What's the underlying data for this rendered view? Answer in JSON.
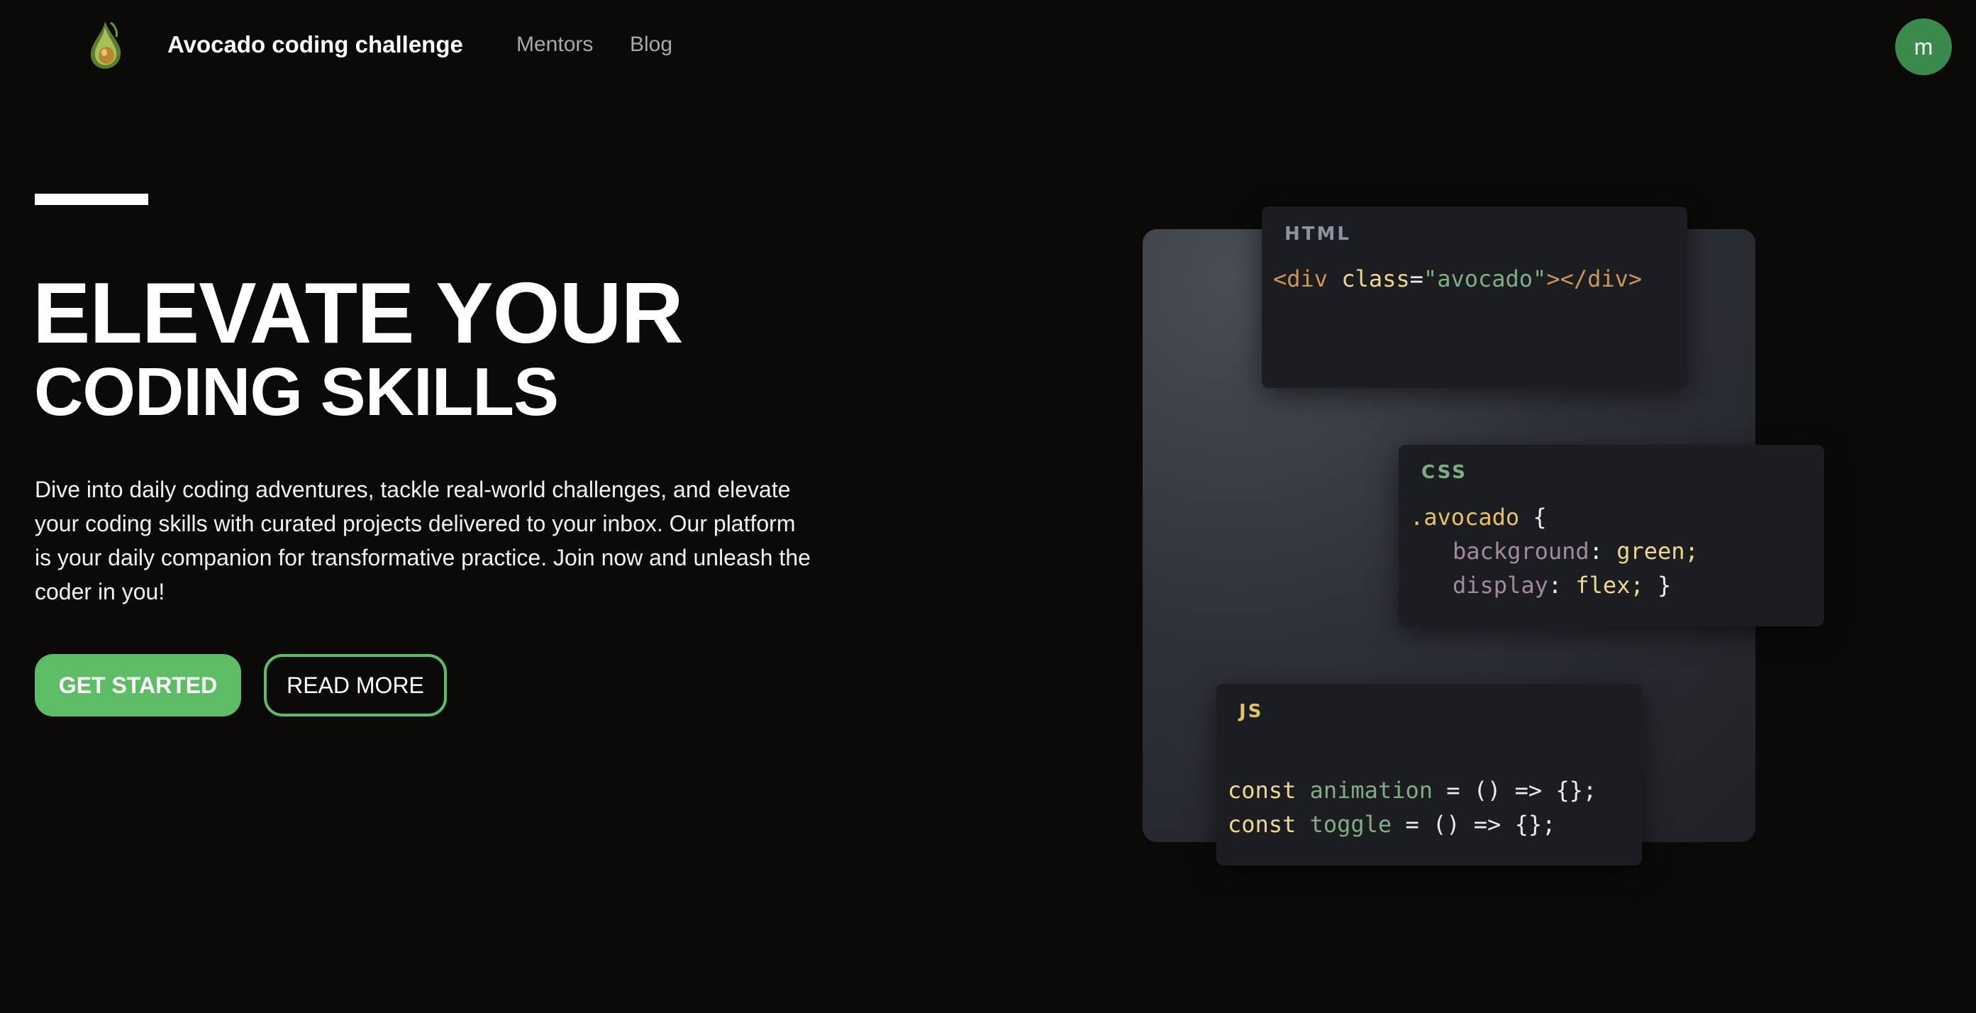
{
  "header": {
    "brand": "Avocado coding challenge",
    "logo_icon": "avocado-logo-icon",
    "nav": [
      {
        "label": "Mentors"
      },
      {
        "label": "Blog"
      }
    ],
    "avatar_initial": "m"
  },
  "hero": {
    "headline_line1": "ELEVATE YOUR",
    "headline_line2": "CODING SKILLS",
    "intro": "Dive into daily coding adventures, tackle real-world challenges, and elevate your coding skills with curated projects delivered to your inbox. Our platform is your daily companion for transformative practice. Join now and unleash the coder in you!",
    "primary_button": "GET STARTED",
    "secondary_button": "READ MORE"
  },
  "code_cards": {
    "html": {
      "label": "HTML",
      "tag_open": "<div",
      "attr": "class",
      "eq": "=",
      "value": "\"avocado\"",
      "tag_close": "></div>"
    },
    "css": {
      "label": "CSS",
      "selector": ".avocado",
      "brace_open": " {",
      "prop1": "background",
      "colon1": ": ",
      "val1": "green;",
      "prop2": "display",
      "colon2": ": ",
      "val2": "flex;",
      "brace_close": " }"
    },
    "js": {
      "label": "JS",
      "keyword1": "const",
      "name1": "animation",
      "rest1": " = () => {};",
      "keyword2": "const",
      "name2": "toggle",
      "rest2": " = () => {};"
    }
  },
  "colors": {
    "background": "#0b0a09",
    "accent_green": "#5dbd65",
    "avatar_green": "#3a8a4c",
    "card_background": "#1c1d20"
  }
}
